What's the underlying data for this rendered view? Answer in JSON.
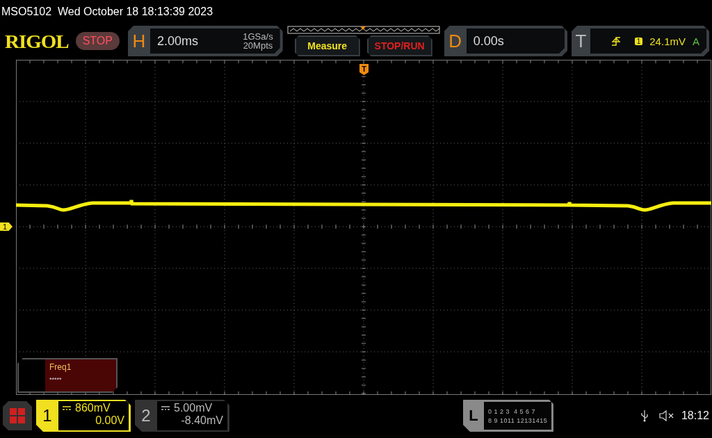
{
  "title_bar": {
    "model": "MSO5102",
    "datetime": "Wed October 18 18:13:39 2023"
  },
  "header": {
    "logo": "RIGOL",
    "run_state": "STOP",
    "horizontal": {
      "label": "H",
      "timebase": "2.00ms",
      "sample_rate": "1GSa/s",
      "memory_depth": "20Mpts"
    },
    "buttons": [
      {
        "label": "Measure",
        "kind": "measure"
      },
      {
        "label": "STOP/RUN",
        "kind": "stoprun"
      }
    ],
    "delay": {
      "label": "D",
      "value": "0.00s"
    },
    "trigger": {
      "label": "T",
      "source": "1",
      "level": "24.1mV",
      "mode": "A"
    }
  },
  "screen": {
    "trigger_marker": "T",
    "channel_marker": "1"
  },
  "measurement": {
    "name": "Freq1",
    "value": "*****"
  },
  "channels": [
    {
      "number": "1",
      "scale": "860mV",
      "offset": "0.00V",
      "selected": true
    },
    {
      "number": "2",
      "scale": "5.00mV",
      "offset": "-8.40mV",
      "selected": false
    }
  ],
  "logic": {
    "label": "L",
    "rows": [
      "0 1 2 3  4 5 6 7",
      "8 9 1011 12131415"
    ]
  },
  "status": {
    "time": "18:12"
  }
}
